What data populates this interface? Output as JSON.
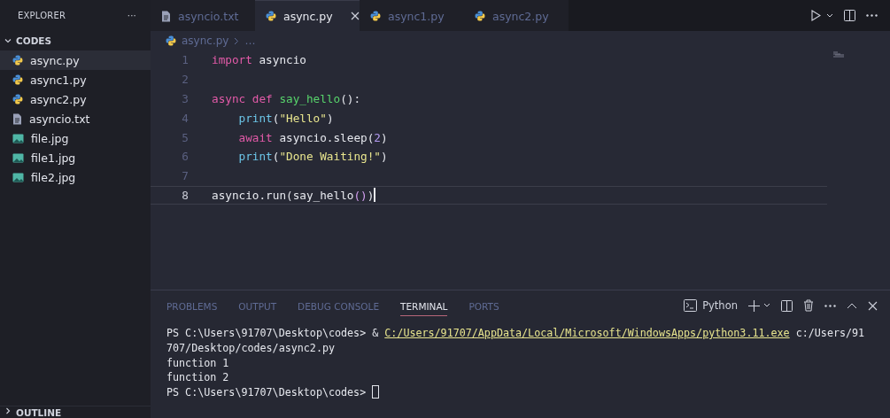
{
  "sidebar": {
    "title": "EXPLORER",
    "more": "···",
    "folder": {
      "name": "CODES",
      "expanded": true
    },
    "files": [
      {
        "name": "async.py",
        "kind": "python",
        "selected": true
      },
      {
        "name": "async1.py",
        "kind": "python",
        "selected": false
      },
      {
        "name": "async2.py",
        "kind": "python",
        "selected": false
      },
      {
        "name": "asyncio.txt",
        "kind": "text",
        "selected": false
      },
      {
        "name": "file.jpg",
        "kind": "image",
        "selected": false
      },
      {
        "name": "file1.jpg",
        "kind": "image",
        "selected": false
      },
      {
        "name": "file2.jpg",
        "kind": "image",
        "selected": false
      }
    ],
    "outline": {
      "name": "OUTLINE",
      "expanded": false
    }
  },
  "tabs": [
    {
      "label": "asyncio.txt",
      "kind": "text",
      "selected": false
    },
    {
      "label": "async.py",
      "kind": "python",
      "selected": true
    },
    {
      "label": "async1.py",
      "kind": "python",
      "selected": false
    },
    {
      "label": "async2.py",
      "kind": "python",
      "selected": false
    }
  ],
  "breadcrumb": {
    "file": "async.py",
    "kind": "python",
    "rest": "…"
  },
  "editor": {
    "lines": [
      {
        "number": "1",
        "current": false,
        "indented": false,
        "words": [
          [
            {
              "text": "import",
              "kind": "keyword"
            }
          ],
          [
            {
              "text": "asyncio",
              "kind": "plain"
            }
          ]
        ]
      },
      {
        "number": "2",
        "current": false
      },
      {
        "number": "3",
        "current": false,
        "indented": false,
        "words": [
          [
            {
              "text": "async",
              "kind": "keyword"
            }
          ],
          [
            {
              "text": "def",
              "kind": "keyword"
            }
          ],
          [
            {
              "text": "say_hello",
              "kind": "function"
            },
            {
              "text": "():",
              "kind": "plain"
            }
          ]
        ]
      },
      {
        "number": "4",
        "current": false,
        "indented": true,
        "words": [
          [
            {
              "text": "print",
              "kind": "builtin"
            },
            {
              "text": "(",
              "kind": "plain"
            },
            {
              "text": "\"Hello\"",
              "kind": "string"
            },
            {
              "text": ")",
              "kind": "plain"
            }
          ]
        ]
      },
      {
        "number": "5",
        "current": false,
        "indented": true,
        "words": [
          [
            {
              "text": "await",
              "kind": "keyword"
            }
          ],
          [
            {
              "text": "asyncio.sleep(",
              "kind": "plain"
            },
            {
              "text": "2",
              "kind": "number"
            },
            {
              "text": ")",
              "kind": "plain"
            }
          ]
        ]
      },
      {
        "number": "6",
        "current": false,
        "indented": true,
        "words": [
          [
            {
              "text": "print",
              "kind": "builtin"
            },
            {
              "text": "(",
              "kind": "plain"
            },
            {
              "text": "\"Done Waiting!\"",
              "kind": "string"
            },
            {
              "text": ")",
              "kind": "plain"
            }
          ]
        ]
      },
      {
        "number": "7",
        "current": false
      },
      {
        "number": "8",
        "current": true,
        "indented": false,
        "words": [
          [
            {
              "text": "asyncio.run(say_hello",
              "kind": "plain"
            },
            {
              "text": "()",
              "kind": "bracket"
            },
            {
              "text": ")",
              "kind": "plain"
            }
          ]
        ]
      }
    ]
  },
  "panel": {
    "tabs": [
      {
        "label": "PROBLEMS",
        "selected": false
      },
      {
        "label": "OUTPUT",
        "selected": false
      },
      {
        "label": "DEBUG CONSOLE",
        "selected": false
      },
      {
        "label": "TERMINAL",
        "selected": true
      },
      {
        "label": "PORTS",
        "selected": false
      }
    ],
    "terminal_name": "Python",
    "terminal": [
      [
        {
          "text": "PS C:\\Users\\91707\\Desktop\\codes> & ",
          "kind": "plain"
        },
        {
          "text": "C:/Users/91707/AppData/Local/Microsoft/WindowsApps/python3.11.exe",
          "kind": "link"
        },
        {
          "text": " c:/Users/91",
          "kind": "plain"
        }
      ],
      [
        {
          "text": "707/Desktop/codes/async2.py",
          "kind": "plain"
        }
      ],
      [
        {
          "text": "function 1",
          "kind": "plain"
        }
      ],
      [
        {
          "text": "function 2",
          "kind": "plain"
        }
      ],
      [
        {
          "text": "PS C:\\Users\\91707\\Desktop\\codes> ",
          "kind": "plain"
        }
      ]
    ]
  }
}
